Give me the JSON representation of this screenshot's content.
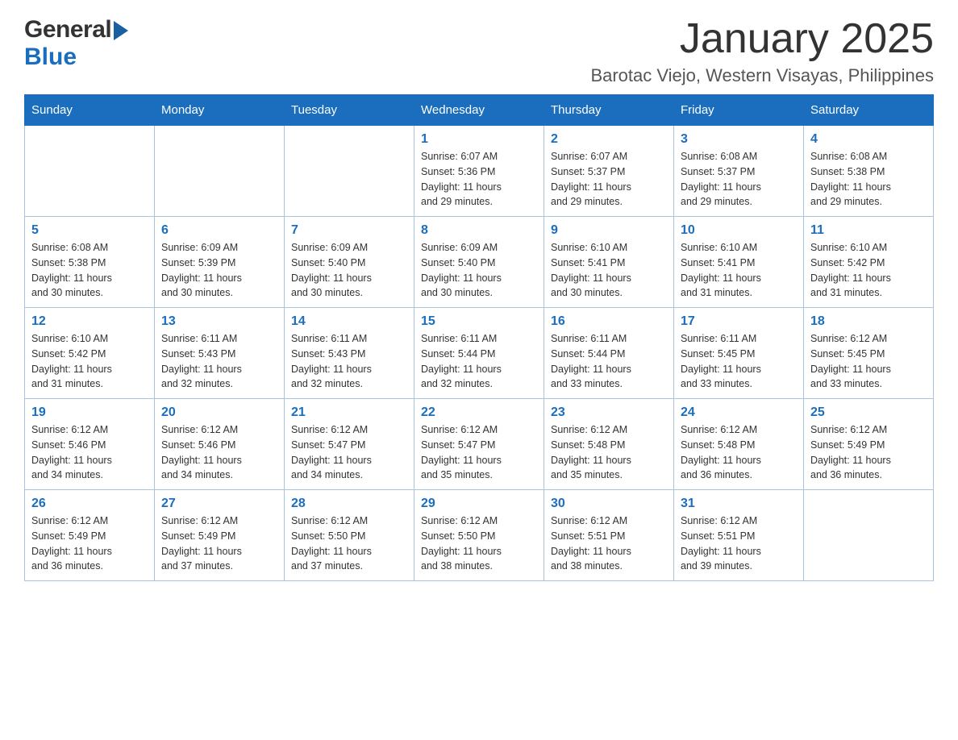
{
  "header": {
    "logo_general": "General",
    "logo_blue": "Blue",
    "month_title": "January 2025",
    "location": "Barotac Viejo, Western Visayas, Philippines"
  },
  "days_of_week": [
    "Sunday",
    "Monday",
    "Tuesday",
    "Wednesday",
    "Thursday",
    "Friday",
    "Saturday"
  ],
  "weeks": [
    {
      "days": [
        {
          "number": "",
          "info": ""
        },
        {
          "number": "",
          "info": ""
        },
        {
          "number": "",
          "info": ""
        },
        {
          "number": "1",
          "info": "Sunrise: 6:07 AM\nSunset: 5:36 PM\nDaylight: 11 hours\nand 29 minutes."
        },
        {
          "number": "2",
          "info": "Sunrise: 6:07 AM\nSunset: 5:37 PM\nDaylight: 11 hours\nand 29 minutes."
        },
        {
          "number": "3",
          "info": "Sunrise: 6:08 AM\nSunset: 5:37 PM\nDaylight: 11 hours\nand 29 minutes."
        },
        {
          "number": "4",
          "info": "Sunrise: 6:08 AM\nSunset: 5:38 PM\nDaylight: 11 hours\nand 29 minutes."
        }
      ]
    },
    {
      "days": [
        {
          "number": "5",
          "info": "Sunrise: 6:08 AM\nSunset: 5:38 PM\nDaylight: 11 hours\nand 30 minutes."
        },
        {
          "number": "6",
          "info": "Sunrise: 6:09 AM\nSunset: 5:39 PM\nDaylight: 11 hours\nand 30 minutes."
        },
        {
          "number": "7",
          "info": "Sunrise: 6:09 AM\nSunset: 5:40 PM\nDaylight: 11 hours\nand 30 minutes."
        },
        {
          "number": "8",
          "info": "Sunrise: 6:09 AM\nSunset: 5:40 PM\nDaylight: 11 hours\nand 30 minutes."
        },
        {
          "number": "9",
          "info": "Sunrise: 6:10 AM\nSunset: 5:41 PM\nDaylight: 11 hours\nand 30 minutes."
        },
        {
          "number": "10",
          "info": "Sunrise: 6:10 AM\nSunset: 5:41 PM\nDaylight: 11 hours\nand 31 minutes."
        },
        {
          "number": "11",
          "info": "Sunrise: 6:10 AM\nSunset: 5:42 PM\nDaylight: 11 hours\nand 31 minutes."
        }
      ]
    },
    {
      "days": [
        {
          "number": "12",
          "info": "Sunrise: 6:10 AM\nSunset: 5:42 PM\nDaylight: 11 hours\nand 31 minutes."
        },
        {
          "number": "13",
          "info": "Sunrise: 6:11 AM\nSunset: 5:43 PM\nDaylight: 11 hours\nand 32 minutes."
        },
        {
          "number": "14",
          "info": "Sunrise: 6:11 AM\nSunset: 5:43 PM\nDaylight: 11 hours\nand 32 minutes."
        },
        {
          "number": "15",
          "info": "Sunrise: 6:11 AM\nSunset: 5:44 PM\nDaylight: 11 hours\nand 32 minutes."
        },
        {
          "number": "16",
          "info": "Sunrise: 6:11 AM\nSunset: 5:44 PM\nDaylight: 11 hours\nand 33 minutes."
        },
        {
          "number": "17",
          "info": "Sunrise: 6:11 AM\nSunset: 5:45 PM\nDaylight: 11 hours\nand 33 minutes."
        },
        {
          "number": "18",
          "info": "Sunrise: 6:12 AM\nSunset: 5:45 PM\nDaylight: 11 hours\nand 33 minutes."
        }
      ]
    },
    {
      "days": [
        {
          "number": "19",
          "info": "Sunrise: 6:12 AM\nSunset: 5:46 PM\nDaylight: 11 hours\nand 34 minutes."
        },
        {
          "number": "20",
          "info": "Sunrise: 6:12 AM\nSunset: 5:46 PM\nDaylight: 11 hours\nand 34 minutes."
        },
        {
          "number": "21",
          "info": "Sunrise: 6:12 AM\nSunset: 5:47 PM\nDaylight: 11 hours\nand 34 minutes."
        },
        {
          "number": "22",
          "info": "Sunrise: 6:12 AM\nSunset: 5:47 PM\nDaylight: 11 hours\nand 35 minutes."
        },
        {
          "number": "23",
          "info": "Sunrise: 6:12 AM\nSunset: 5:48 PM\nDaylight: 11 hours\nand 35 minutes."
        },
        {
          "number": "24",
          "info": "Sunrise: 6:12 AM\nSunset: 5:48 PM\nDaylight: 11 hours\nand 36 minutes."
        },
        {
          "number": "25",
          "info": "Sunrise: 6:12 AM\nSunset: 5:49 PM\nDaylight: 11 hours\nand 36 minutes."
        }
      ]
    },
    {
      "days": [
        {
          "number": "26",
          "info": "Sunrise: 6:12 AM\nSunset: 5:49 PM\nDaylight: 11 hours\nand 36 minutes."
        },
        {
          "number": "27",
          "info": "Sunrise: 6:12 AM\nSunset: 5:49 PM\nDaylight: 11 hours\nand 37 minutes."
        },
        {
          "number": "28",
          "info": "Sunrise: 6:12 AM\nSunset: 5:50 PM\nDaylight: 11 hours\nand 37 minutes."
        },
        {
          "number": "29",
          "info": "Sunrise: 6:12 AM\nSunset: 5:50 PM\nDaylight: 11 hours\nand 38 minutes."
        },
        {
          "number": "30",
          "info": "Sunrise: 6:12 AM\nSunset: 5:51 PM\nDaylight: 11 hours\nand 38 minutes."
        },
        {
          "number": "31",
          "info": "Sunrise: 6:12 AM\nSunset: 5:51 PM\nDaylight: 11 hours\nand 39 minutes."
        },
        {
          "number": "",
          "info": ""
        }
      ]
    }
  ]
}
